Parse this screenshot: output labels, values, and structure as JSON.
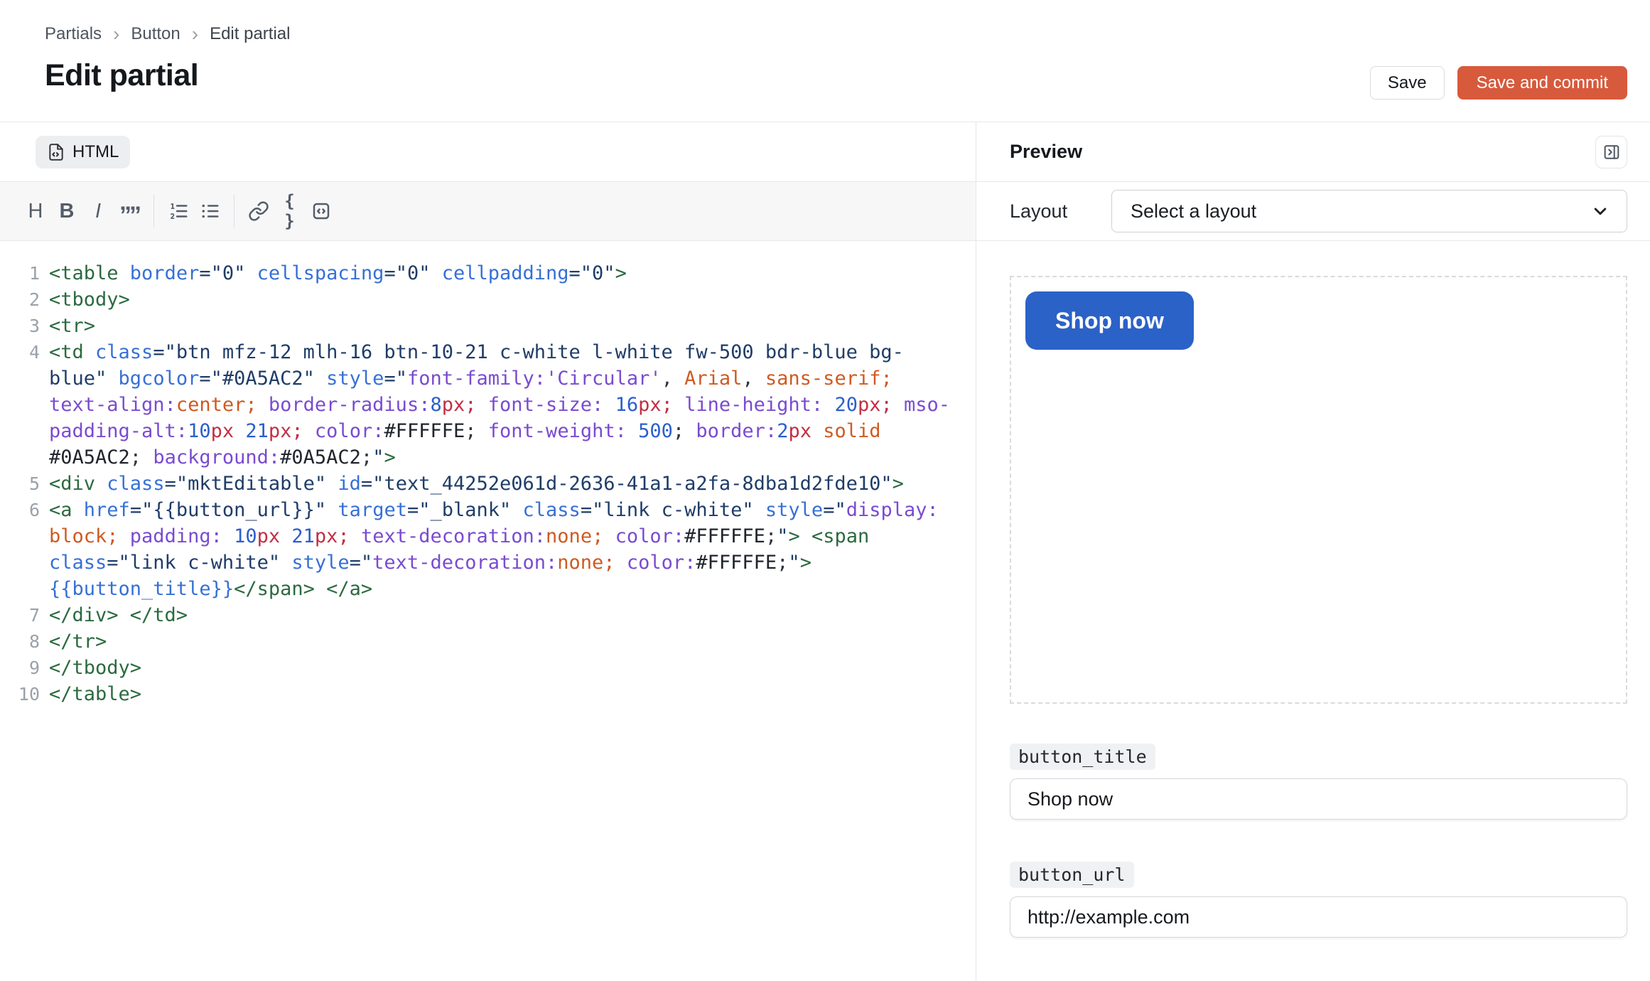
{
  "breadcrumb": {
    "separator": "›",
    "items": [
      "Partials",
      "Button",
      "Edit partial"
    ]
  },
  "page": {
    "title": "Edit partial"
  },
  "header": {
    "save_label": "Save",
    "save_commit_label": "Save and commit"
  },
  "editor": {
    "tab_label": "HTML",
    "toolbar": {
      "items": [
        {
          "name": "heading",
          "glyph": "H"
        },
        {
          "name": "bold",
          "glyph": "B"
        },
        {
          "name": "italic",
          "glyph": "I"
        },
        {
          "name": "blockquote",
          "glyph": "””"
        },
        {
          "name": "divider"
        },
        {
          "name": "ordered-list",
          "glyph": "svg"
        },
        {
          "name": "unordered-list",
          "glyph": "svg"
        },
        {
          "name": "divider"
        },
        {
          "name": "link",
          "glyph": "svg"
        },
        {
          "name": "braces",
          "glyph": "{ }"
        },
        {
          "name": "code-block",
          "glyph": "svg"
        }
      ]
    },
    "code": {
      "lines": [
        {
          "num": "1",
          "tokens": [
            [
              "t",
              "<table "
            ],
            [
              "a",
              "border"
            ],
            [
              "s",
              "=\"0\" "
            ],
            [
              "a",
              "cellspacing"
            ],
            [
              "s",
              "=\"0\" "
            ],
            [
              "a",
              "cellpadding"
            ],
            [
              "s",
              "=\"0\""
            ],
            [
              "t",
              ">"
            ]
          ]
        },
        {
          "num": "2",
          "tokens": [
            [
              "t",
              "<tbody>"
            ]
          ]
        },
        {
          "num": "3",
          "tokens": [
            [
              "t",
              "<tr>"
            ]
          ]
        },
        {
          "num": "4",
          "tokens": [
            [
              "t",
              "<td "
            ],
            [
              "a",
              "class"
            ],
            [
              "s",
              "=\"btn mfz-12 mlh-16 btn-10-21 c-white l-white fw-500 bdr-blue bg-blue\" "
            ],
            [
              "a",
              "bgcolor"
            ],
            [
              "s",
              "=\"#0A5AC2\" "
            ],
            [
              "a",
              "style"
            ],
            [
              "s",
              "=\""
            ],
            [
              "p",
              "font-family:"
            ],
            [
              "p",
              "'Circular'"
            ],
            [
              "d",
              ", "
            ],
            [
              "k",
              "Arial"
            ],
            [
              "d",
              ", "
            ],
            [
              "k",
              "sans-serif"
            ],
            [
              "k",
              "; "
            ],
            [
              "p",
              "text-align:"
            ],
            [
              "k",
              "center"
            ],
            [
              "k",
              "; "
            ],
            [
              "p",
              "border-radius:"
            ],
            [
              "n",
              "8"
            ],
            [
              "u",
              "px"
            ],
            [
              "u",
              "; "
            ],
            [
              "p",
              "font-size: "
            ],
            [
              "n",
              "16"
            ],
            [
              "u",
              "px"
            ],
            [
              "u",
              "; "
            ],
            [
              "p",
              "line-height: "
            ],
            [
              "n",
              "20"
            ],
            [
              "u",
              "px"
            ],
            [
              "u",
              "; "
            ],
            [
              "p",
              "mso-padding-alt:"
            ],
            [
              "n",
              "10"
            ],
            [
              "u",
              "px"
            ],
            [
              "d",
              " "
            ],
            [
              "n",
              "21"
            ],
            [
              "u",
              "px"
            ],
            [
              "u",
              "; "
            ],
            [
              "p",
              "color:"
            ],
            [
              "h",
              "#FFFFFE"
            ],
            [
              "d",
              "; "
            ],
            [
              "p",
              "font-weight: "
            ],
            [
              "n",
              "500"
            ],
            [
              "d",
              "; "
            ],
            [
              "p",
              "border:"
            ],
            [
              "n",
              "2"
            ],
            [
              "u",
              "px "
            ],
            [
              "k",
              "solid "
            ],
            [
              "h",
              "#0A5AC2"
            ],
            [
              "d",
              "; "
            ],
            [
              "p",
              "background:"
            ],
            [
              "h",
              "#0A5AC2"
            ],
            [
              "d",
              ";"
            ],
            [
              "s",
              "\""
            ],
            [
              "t",
              ">"
            ]
          ]
        },
        {
          "num": "5",
          "tokens": [
            [
              "t",
              "<div "
            ],
            [
              "a",
              "class"
            ],
            [
              "s",
              "=\"mktEditable\" "
            ],
            [
              "a",
              "id"
            ],
            [
              "s",
              "=\"text_44252e061d-2636-41a1-a2fa-8dba1d2fde10\""
            ],
            [
              "t",
              ">"
            ]
          ]
        },
        {
          "num": "6",
          "tokens": [
            [
              "t",
              "<a "
            ],
            [
              "a",
              "href"
            ],
            [
              "s",
              "=\"{{button_url}}\" "
            ],
            [
              "a",
              "target"
            ],
            [
              "s",
              "=\"_blank\" "
            ],
            [
              "a",
              "class"
            ],
            [
              "s",
              "=\"link c-white\" "
            ],
            [
              "a",
              "style"
            ],
            [
              "s",
              "=\""
            ],
            [
              "p",
              "display:"
            ],
            [
              "d",
              " "
            ],
            [
              "k",
              "block"
            ],
            [
              "k",
              "; "
            ],
            [
              "p",
              "padding: "
            ],
            [
              "n",
              "10"
            ],
            [
              "u",
              "px "
            ],
            [
              "n",
              "21"
            ],
            [
              "u",
              "px"
            ],
            [
              "u",
              "; "
            ],
            [
              "p",
              "text-decoration:"
            ],
            [
              "k",
              "none"
            ],
            [
              "k",
              "; "
            ],
            [
              "p",
              "color:"
            ],
            [
              "h",
              "#FFFFFE"
            ],
            [
              "d",
              ";"
            ],
            [
              "s",
              "\""
            ],
            [
              "t",
              ">"
            ],
            [
              "d",
              " "
            ],
            [
              "t",
              "<span "
            ],
            [
              "a",
              "class"
            ],
            [
              "s",
              "=\"link c-white\" "
            ],
            [
              "a",
              "style"
            ],
            [
              "s",
              "=\""
            ],
            [
              "p",
              "text-decoration:"
            ],
            [
              "k",
              "none"
            ],
            [
              "k",
              "; "
            ],
            [
              "p",
              "color:"
            ],
            [
              "h",
              "#FFFFFE"
            ],
            [
              "d",
              ";"
            ],
            [
              "s",
              "\""
            ],
            [
              "t",
              ">"
            ],
            [
              "d",
              " "
            ],
            [
              "v",
              "{{button_title}}"
            ],
            [
              "t",
              "</span> </a>"
            ]
          ]
        },
        {
          "num": "7",
          "tokens": [
            [
              "t",
              "</div> </td>"
            ]
          ]
        },
        {
          "num": "8",
          "tokens": [
            [
              "t",
              "</tr>"
            ]
          ]
        },
        {
          "num": "9",
          "tokens": [
            [
              "t",
              "</tbody>"
            ]
          ]
        },
        {
          "num": "10",
          "tokens": [
            [
              "t",
              "</table>"
            ]
          ]
        }
      ]
    }
  },
  "preview": {
    "title": "Preview",
    "layout_label": "Layout",
    "layout_select_value": "Select a layout",
    "button_preview_text": "Shop now",
    "fields": [
      {
        "name": "button_title",
        "value": "Shop now"
      },
      {
        "name": "button_url",
        "value": "http://example.com"
      }
    ]
  },
  "colors": {
    "accent_orange": "#D75A3C",
    "preview_button_blue": "#2B62C8",
    "code_tag_green": "#2B6A3F",
    "code_attr_blue": "#3670D6",
    "code_string_navy": "#1F3D68",
    "code_property_purple": "#7A4BD0",
    "code_unit_crimson": "#C22F45",
    "code_keyword_orange": "#CF5A22"
  }
}
